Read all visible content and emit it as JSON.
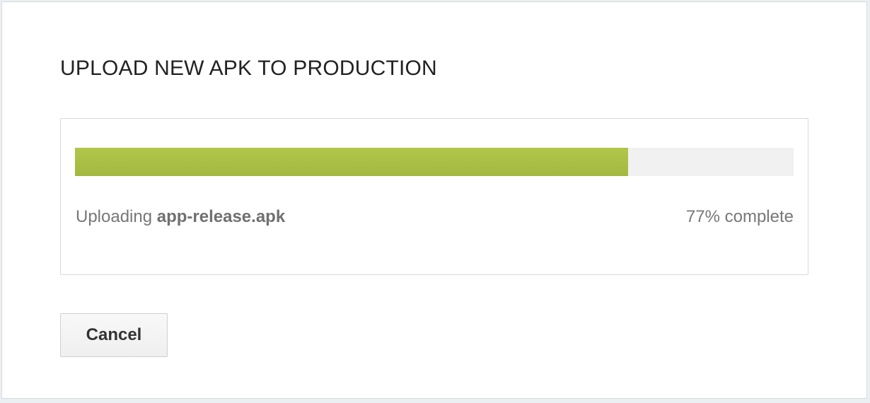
{
  "dialog": {
    "title": "UPLOAD NEW APK TO PRODUCTION"
  },
  "upload": {
    "status_prefix": "Uploading ",
    "filename": "app-release.apk",
    "progress_text": "77% complete",
    "progress_fraction": 0.77,
    "colors": {
      "progress_fill": "#a9c146",
      "progress_track": "#f1f1f1"
    }
  },
  "actions": {
    "cancel_label": "Cancel"
  }
}
